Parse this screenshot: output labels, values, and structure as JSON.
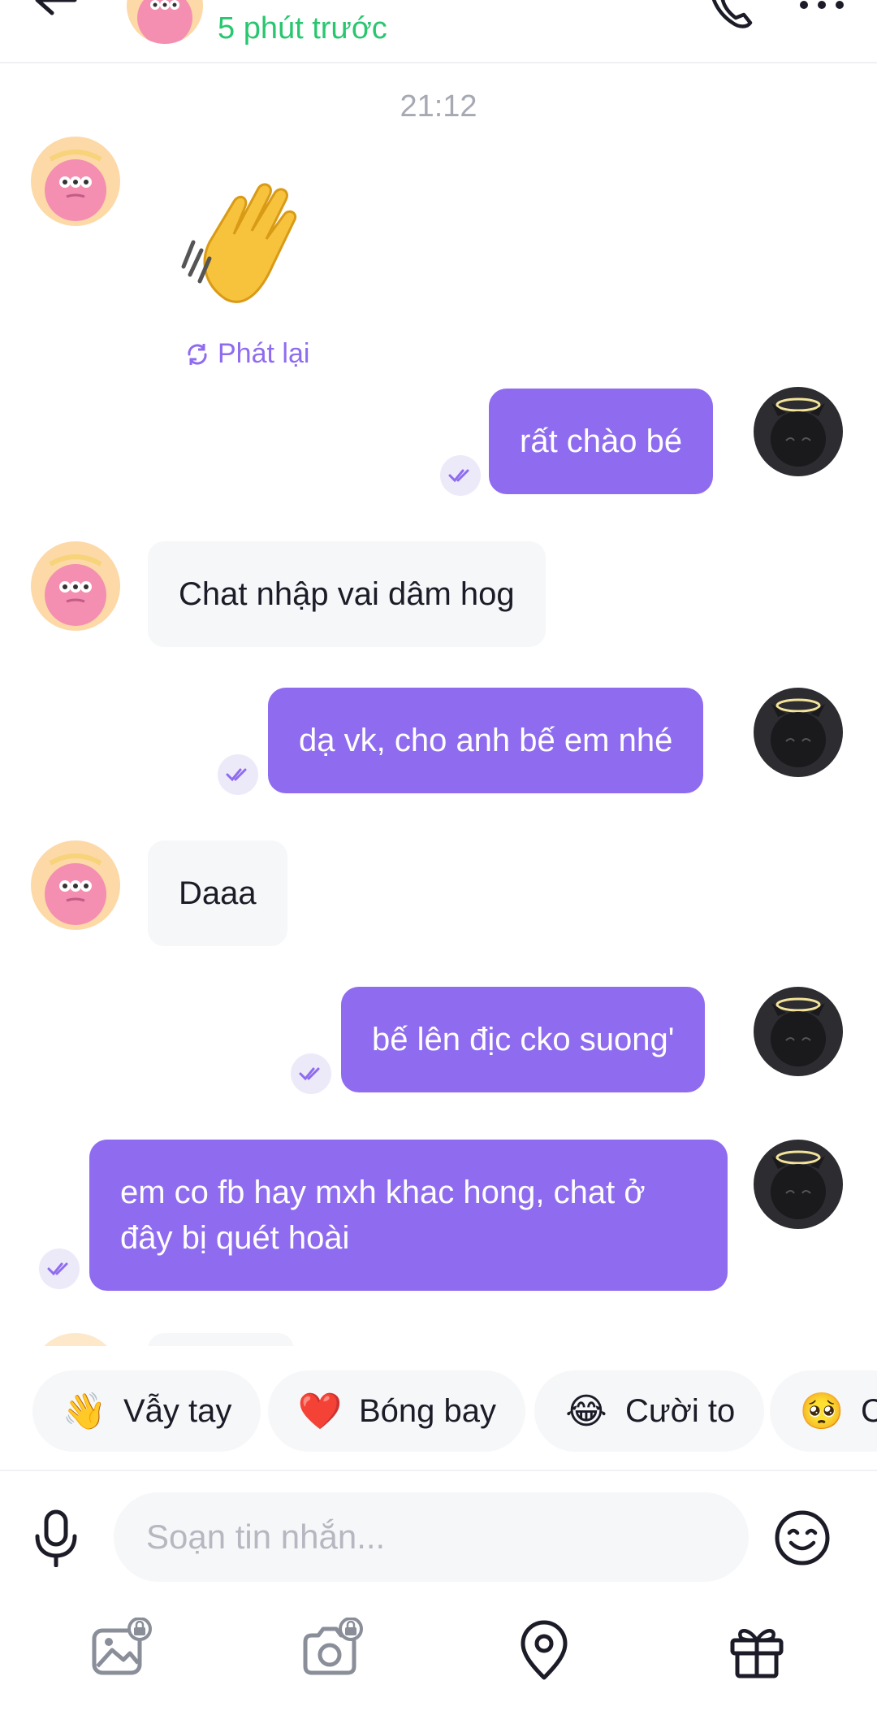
{
  "header": {
    "status": "5 phút trước",
    "icons": [
      "back-arrow-icon",
      "phone-icon",
      "more-icon"
    ]
  },
  "chat": {
    "timestamp": "21:12",
    "replay_label": "Phát lại",
    "messages": [
      {
        "from": "me",
        "text": "rất chào bé"
      },
      {
        "from": "other",
        "text": "Chat nhập vai dâm hog"
      },
      {
        "from": "me",
        "text": "dạ vk, cho anh bế em nhé"
      },
      {
        "from": "other",
        "text": "Daaa"
      },
      {
        "from": "me",
        "text": "bế lên địc cko suong'"
      },
      {
        "from": "me",
        "text_line1": "em co fb hay mxh khac hong, chat ở",
        "text_line2": "đây bị quét hoài"
      }
    ]
  },
  "quick_reactions": [
    {
      "emoji": "👋",
      "label": "Vẫy tay"
    },
    {
      "emoji": "❤️",
      "label": "Bóng bay"
    },
    {
      "emoji": "😂",
      "label": "Cười to"
    },
    {
      "emoji": "🥺",
      "label": "C"
    }
  ],
  "composer": {
    "placeholder": "Soạn tin nhắn..."
  },
  "toolbar": [
    "gallery-icon",
    "camera-icon",
    "location-icon",
    "gift-icon"
  ],
  "colors": {
    "accent": "#8f6cef",
    "online_status": "#28c76f",
    "bubble_other": "#f6f7f9"
  }
}
